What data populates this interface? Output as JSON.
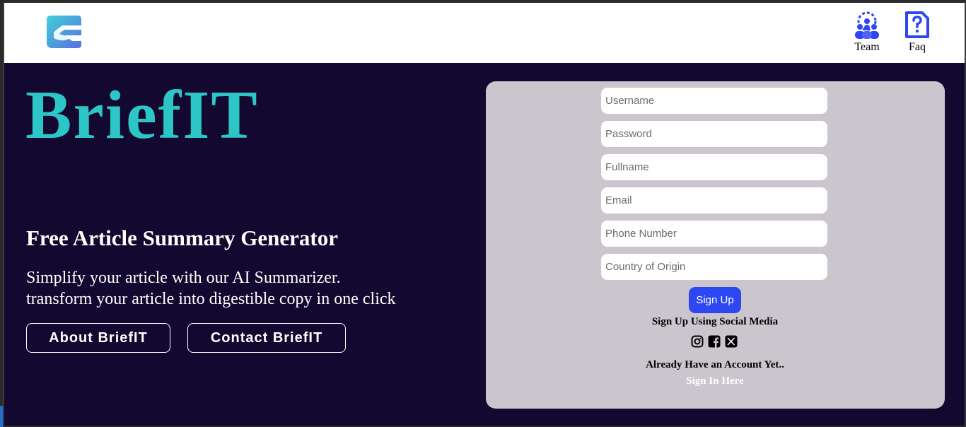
{
  "nav": {
    "team_label": "Team",
    "faq_label": "Faq"
  },
  "hero": {
    "brand": "BriefIT",
    "subtitle": "Free Article Summary Generator",
    "desc_line1": "Simplify your article with our AI Summarizer.",
    "desc_line2": "transform your article into digestible copy in one click",
    "about_label": "About BriefIT",
    "contact_label": "Contact BriefIT"
  },
  "form": {
    "username_placeholder": "Username",
    "password_placeholder": "Password",
    "fullname_placeholder": "Fullname",
    "email_placeholder": "Email",
    "phone_placeholder": "Phone Number",
    "country_placeholder": "Country of Origin",
    "signup_label": "Sign Up",
    "social_label": "Sign Up Using Social Media",
    "account_label": "Already Have an Account Yet..",
    "signin_label": "Sign In Here"
  },
  "icons": {
    "logo": "brief-logo-icon",
    "team": "team-gear-icon",
    "faq": "faq-document-icon",
    "social": [
      "instagram-icon",
      "facebook-icon",
      "x-icon"
    ]
  },
  "colors": {
    "background": "#130830",
    "brand": "#2cc6c6",
    "panel": "#cbc6cd",
    "button": "#2d47f2",
    "nav_icon": "#2d47f2"
  }
}
